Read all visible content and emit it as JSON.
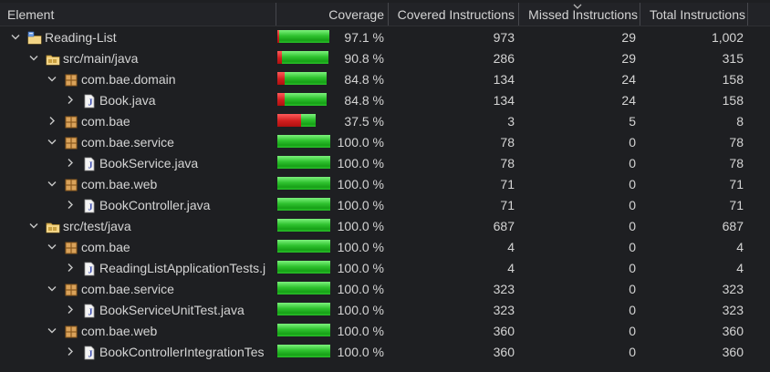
{
  "header": {
    "element": "Element",
    "coverage": "Coverage",
    "covered": "Covered Instructions",
    "missed": "Missed Instructions",
    "total": "Total Instructions"
  },
  "rows": [
    {
      "name": "Reading-List",
      "type": "project",
      "depth": 0,
      "expanded": true,
      "coverage": "97.1 %",
      "covered": "973",
      "missed": "29",
      "total": "1,002",
      "covered_fraction": 0.971
    },
    {
      "name": "src/main/java",
      "type": "source-folder",
      "depth": 1,
      "expanded": true,
      "coverage": "90.8 %",
      "covered": "286",
      "missed": "29",
      "total": "315",
      "covered_fraction": 0.908
    },
    {
      "name": "com.bae.domain",
      "type": "package",
      "depth": 2,
      "expanded": true,
      "coverage": "84.8 %",
      "covered": "134",
      "missed": "24",
      "total": "158",
      "covered_fraction": 0.848
    },
    {
      "name": "Book.java",
      "type": "java-file",
      "depth": 3,
      "expanded": false,
      "coverage": "84.8 %",
      "covered": "134",
      "missed": "24",
      "total": "158",
      "covered_fraction": 0.848
    },
    {
      "name": "com.bae",
      "type": "package",
      "depth": 2,
      "expanded": false,
      "coverage": "37.5 %",
      "covered": "3",
      "missed": "5",
      "total": "8",
      "covered_fraction": 0.375
    },
    {
      "name": "com.bae.service",
      "type": "package",
      "depth": 2,
      "expanded": true,
      "coverage": "100.0 %",
      "covered": "78",
      "missed": "0",
      "total": "78",
      "covered_fraction": 1.0
    },
    {
      "name": "BookService.java",
      "type": "java-file",
      "depth": 3,
      "expanded": false,
      "coverage": "100.0 %",
      "covered": "78",
      "missed": "0",
      "total": "78",
      "covered_fraction": 1.0
    },
    {
      "name": "com.bae.web",
      "type": "package",
      "depth": 2,
      "expanded": true,
      "coverage": "100.0 %",
      "covered": "71",
      "missed": "0",
      "total": "71",
      "covered_fraction": 1.0
    },
    {
      "name": "BookController.java",
      "type": "java-file",
      "depth": 3,
      "expanded": false,
      "coverage": "100.0 %",
      "covered": "71",
      "missed": "0",
      "total": "71",
      "covered_fraction": 1.0
    },
    {
      "name": "src/test/java",
      "type": "source-folder",
      "depth": 1,
      "expanded": true,
      "coverage": "100.0 %",
      "covered": "687",
      "missed": "0",
      "total": "687",
      "covered_fraction": 1.0
    },
    {
      "name": "com.bae",
      "type": "package",
      "depth": 2,
      "expanded": true,
      "coverage": "100.0 %",
      "covered": "4",
      "missed": "0",
      "total": "4",
      "covered_fraction": 1.0
    },
    {
      "name": "ReadingListApplicationTests.j",
      "type": "java-file",
      "depth": 3,
      "expanded": false,
      "coverage": "100.0 %",
      "covered": "4",
      "missed": "0",
      "total": "4",
      "covered_fraction": 1.0
    },
    {
      "name": "com.bae.service",
      "type": "package",
      "depth": 2,
      "expanded": true,
      "coverage": "100.0 %",
      "covered": "323",
      "missed": "0",
      "total": "323",
      "covered_fraction": 1.0
    },
    {
      "name": "BookServiceUnitTest.java",
      "type": "java-file",
      "depth": 3,
      "expanded": false,
      "coverage": "100.0 %",
      "covered": "323",
      "missed": "0",
      "total": "323",
      "covered_fraction": 1.0
    },
    {
      "name": "com.bae.web",
      "type": "package",
      "depth": 2,
      "expanded": true,
      "coverage": "100.0 %",
      "covered": "360",
      "missed": "0",
      "total": "360",
      "covered_fraction": 1.0
    },
    {
      "name": "BookControllerIntegrationTes",
      "type": "java-file",
      "depth": 3,
      "expanded": false,
      "coverage": "100.0 %",
      "covered": "360",
      "missed": "0",
      "total": "360",
      "covered_fraction": 1.0
    }
  ],
  "colors": {
    "covered": "#2fc22f",
    "missed": "#d01e1e",
    "background": "#1e1f22"
  }
}
